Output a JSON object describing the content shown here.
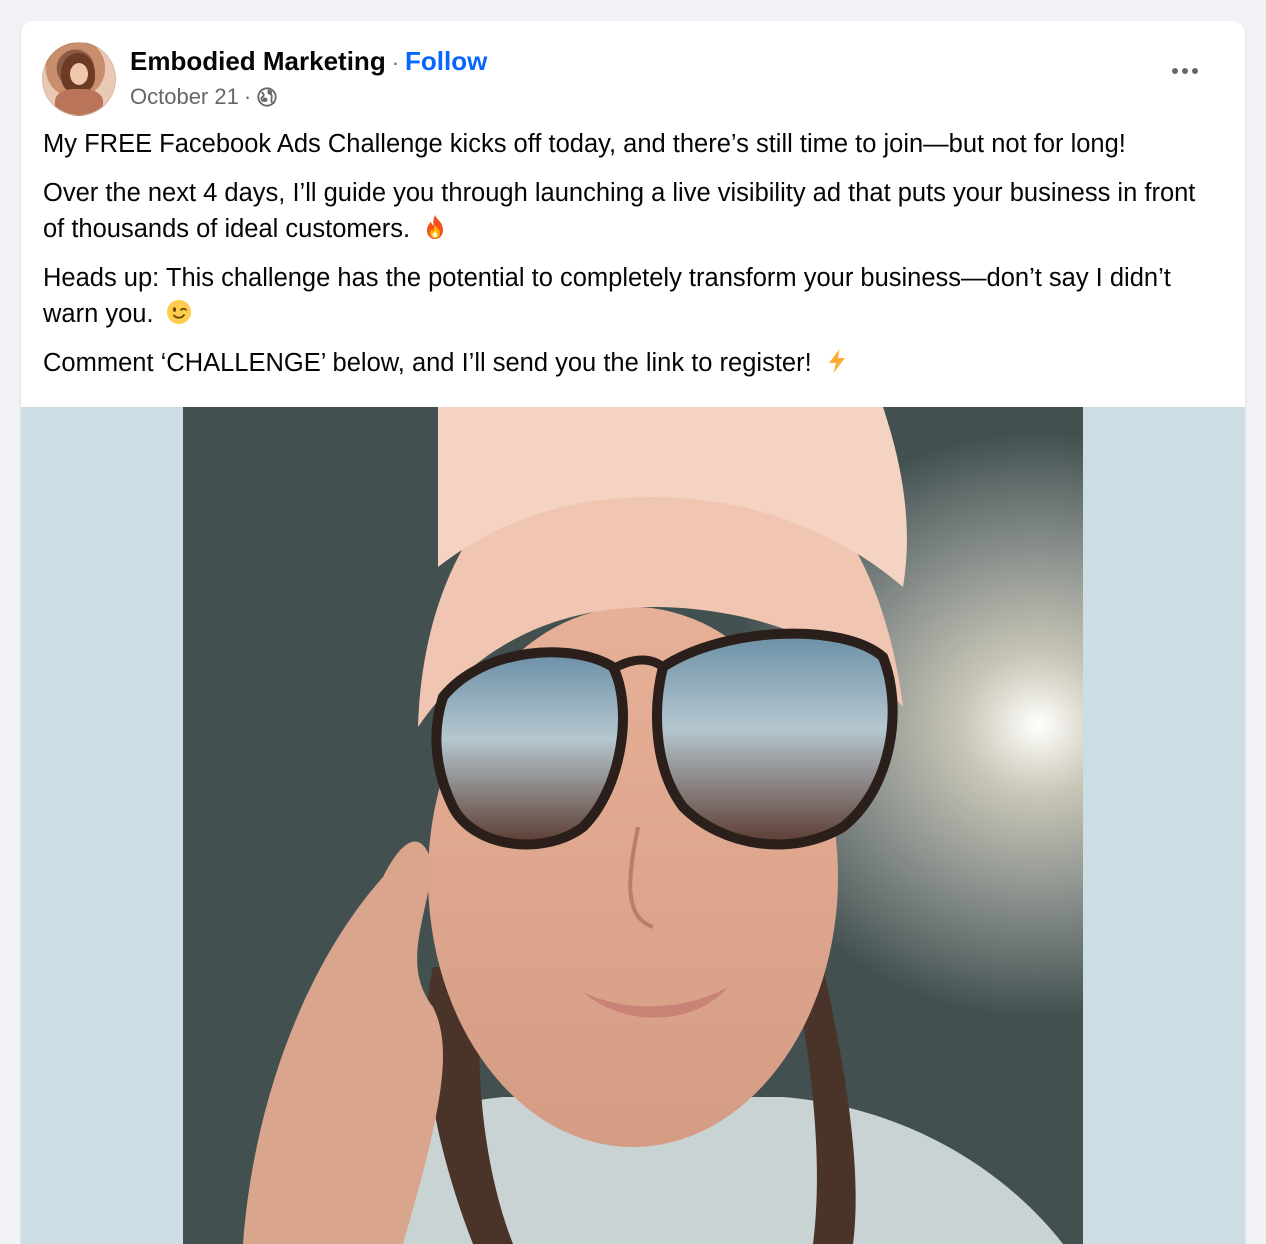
{
  "post": {
    "author": "Embodied Marketing",
    "separator": "·",
    "follow_label": "Follow",
    "date": "October 21",
    "audience_icon": "globe-icon",
    "more_icon": "more-options-icon",
    "paragraphs": [
      {
        "text": "My FREE Facebook Ads Challenge kicks off today, and there’s still time to join—but not for long!",
        "emoji": null
      },
      {
        "text": "Over the next 4 days, I’ll guide you through launching a live visibility ad that puts your business in front of thousands of ideal customers.",
        "emoji": "fire-emoji"
      },
      {
        "text": "Heads up: This challenge has the potential to completely transform your business—don’t say I didn’t warn you.",
        "emoji": "winking-face-emoji"
      },
      {
        "text": "Comment ‘CHALLENGE’ below, and I’ll send you the link to register!",
        "emoji": "lightning-emoji"
      }
    ]
  },
  "colors": {
    "follow": "#0866ff",
    "secondary_text": "#65676b",
    "media_background": "#cddde4"
  }
}
